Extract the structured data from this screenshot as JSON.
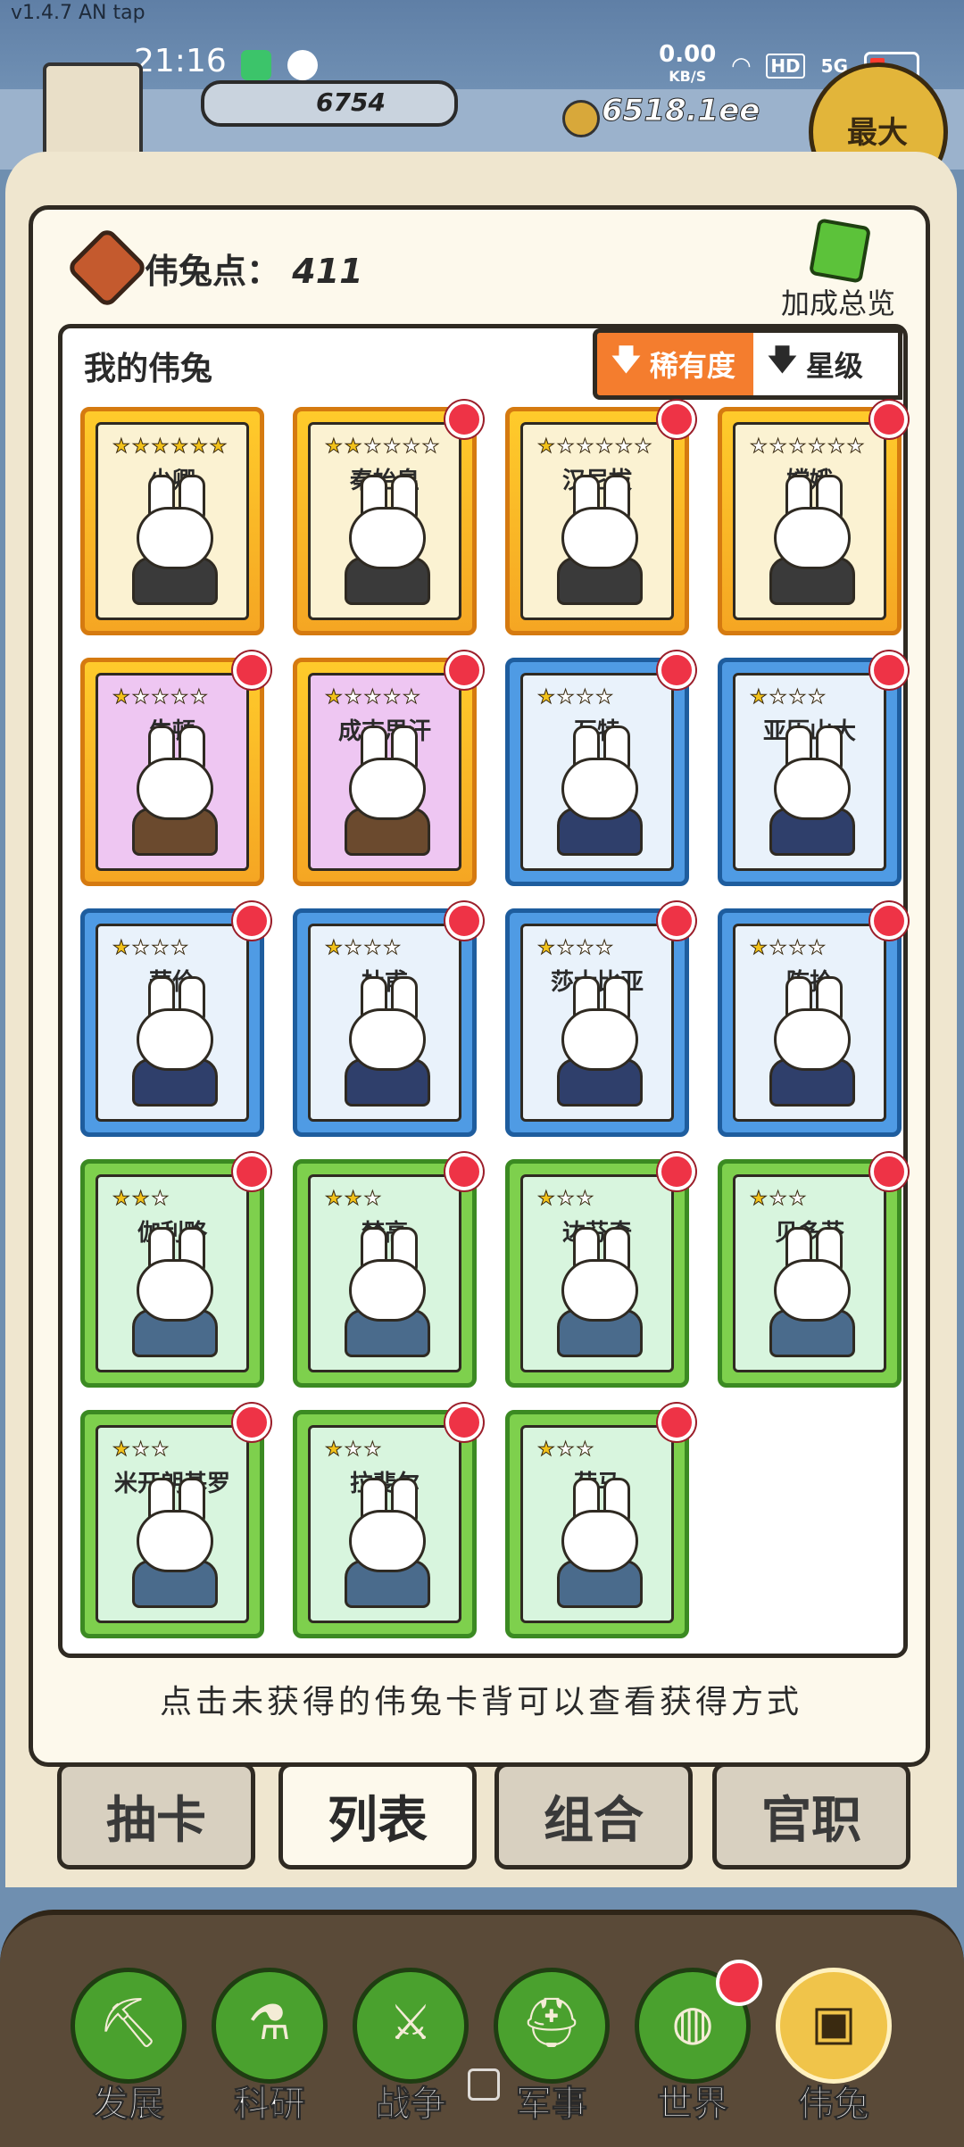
{
  "version_label": "v1.4.7 AN tap",
  "status": {
    "time": "21:16",
    "net_speed": "0.00",
    "net_unit": "KB/S",
    "hd": "HD",
    "signal": "5G"
  },
  "resources": {
    "wood": "6754",
    "gold": "6518.1ee",
    "max_label": "最大"
  },
  "header": {
    "points_label": "伟兔点：",
    "points_value": "411",
    "bonus_label": "加成总览"
  },
  "list": {
    "title": "我的伟兔",
    "sort_rarity": "稀有度",
    "sort_star": "星级"
  },
  "cards": [
    {
      "name": "少卿",
      "stars": 6,
      "max": 6,
      "rarity": "gold",
      "badge": false
    },
    {
      "name": "秦始皇",
      "stars": 2,
      "max": 6,
      "rarity": "gold",
      "badge": true
    },
    {
      "name": "汉尼拔",
      "stars": 1,
      "max": 6,
      "rarity": "gold",
      "badge": true
    },
    {
      "name": "嫦娥",
      "stars": 0,
      "max": 6,
      "rarity": "gold",
      "badge": true
    },
    {
      "name": "牛顿",
      "stars": 1,
      "max": 5,
      "rarity": "purple",
      "badge": true
    },
    {
      "name": "成吉思汗",
      "stars": 1,
      "max": 5,
      "rarity": "purple",
      "badge": true
    },
    {
      "name": "瓦特",
      "stars": 1,
      "max": 4,
      "rarity": "blue",
      "badge": true
    },
    {
      "name": "亚历山大",
      "stars": 1,
      "max": 4,
      "rarity": "blue",
      "badge": true
    },
    {
      "name": "華伦",
      "stars": 1,
      "max": 4,
      "rarity": "blue",
      "badge": true
    },
    {
      "name": "杜甫",
      "stars": 1,
      "max": 4,
      "rarity": "blue",
      "badge": true
    },
    {
      "name": "莎士比亚",
      "stars": 1,
      "max": 4,
      "rarity": "blue",
      "badge": true
    },
    {
      "name": "陈拾",
      "stars": 1,
      "max": 4,
      "rarity": "blue",
      "badge": true
    },
    {
      "name": "伽利略",
      "stars": 2,
      "max": 3,
      "rarity": "green",
      "badge": true
    },
    {
      "name": "梵高",
      "stars": 2,
      "max": 3,
      "rarity": "green",
      "badge": true
    },
    {
      "name": "达芬奇",
      "stars": 1,
      "max": 3,
      "rarity": "green",
      "badge": true
    },
    {
      "name": "贝多芬",
      "stars": 1,
      "max": 3,
      "rarity": "green",
      "badge": true
    },
    {
      "name": "米开朗基罗",
      "stars": 1,
      "max": 3,
      "rarity": "green",
      "badge": true
    },
    {
      "name": "拉斐尔",
      "stars": 1,
      "max": 3,
      "rarity": "green",
      "badge": true
    },
    {
      "name": "荷马",
      "stars": 1,
      "max": 3,
      "rarity": "green",
      "badge": true
    }
  ],
  "hint": "点击未获得的伟兔卡背可以查看获得方式",
  "tabs": {
    "draw": "抽卡",
    "list": "列表",
    "combo": "组合",
    "office": "官职"
  },
  "nav": {
    "develop": "发展",
    "research": "科研",
    "war": "战争",
    "military": "军事",
    "world": "世界",
    "rabbits": "伟兔"
  },
  "colors": {
    "badge_red": "#ee3346",
    "sort_active": "#f47d2e",
    "star": "#f2c21a"
  }
}
